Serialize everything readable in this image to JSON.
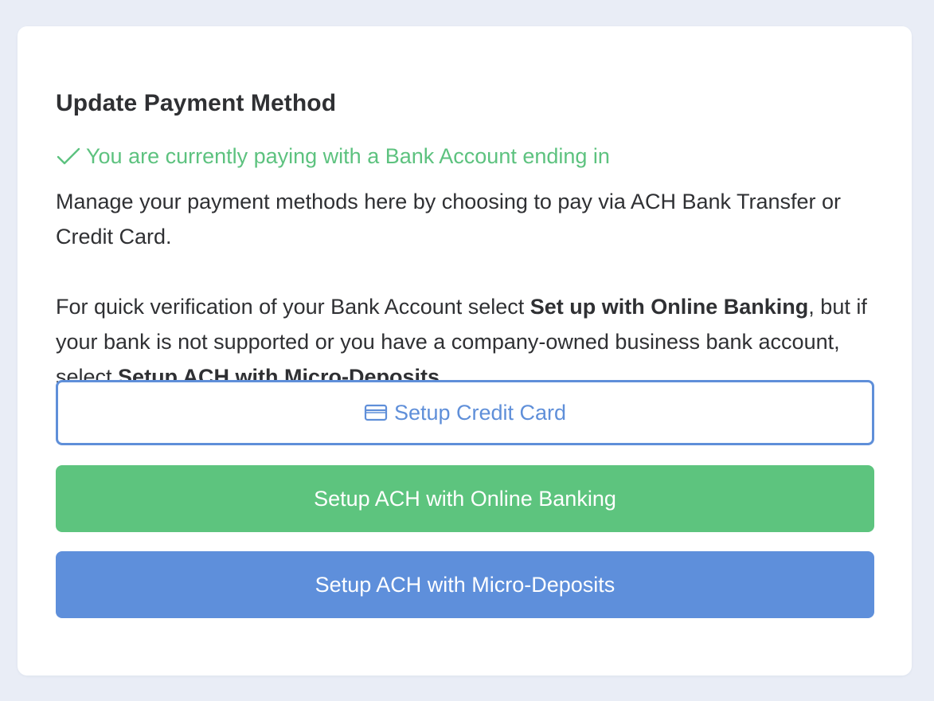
{
  "card": {
    "title": "Update Payment Method",
    "status": {
      "icon": "check-icon",
      "text": "You are currently paying with a Bank Account ending in",
      "color": "#5dc27f"
    },
    "description": {
      "para1": "Manage your payment methods here by choosing to pay via ACH Bank Transfer or Credit Card.",
      "para2_part1": "For quick verification of your Bank Account select ",
      "para2_bold1": "Set up with Online Banking",
      "para2_part2": ", but if your bank is not supported or you have a company-owned business bank account, select ",
      "para2_bold2": "Setup ACH with Micro-Deposits",
      "para2_part3": "."
    },
    "buttons": {
      "credit_card": {
        "label": "Setup Credit Card",
        "icon": "credit-card-icon",
        "color": "#5f8fd9"
      },
      "online_banking": {
        "label": "Setup ACH with Online Banking",
        "color": "#5dc47e"
      },
      "micro_deposits": {
        "label": "Setup ACH with Micro-Deposits",
        "color": "#5e8fdb"
      }
    }
  }
}
